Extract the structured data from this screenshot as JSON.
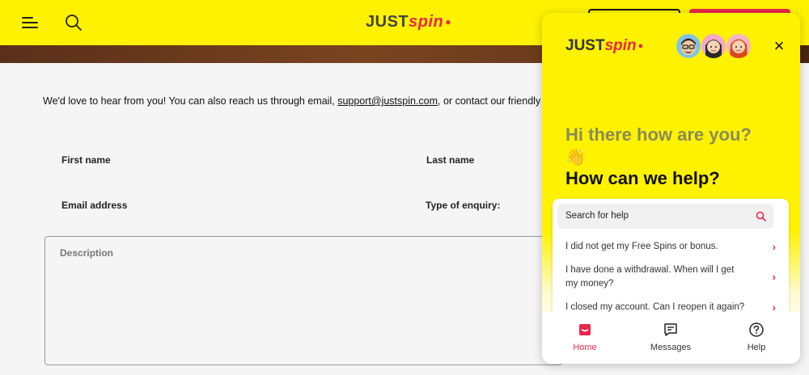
{
  "header": {
    "brand_just": "JUST",
    "brand_spin": "spin",
    "accent": "#e8284a",
    "background": "#fff200"
  },
  "contact": {
    "intro_prefix": "We'd love to hear from you! You can also reach us through email, ",
    "email": "support@justspin.com",
    "intro_suffix": ", or contact our friendly c",
    "first_name_label": "First name",
    "last_name_label": "Last name",
    "email_label": "Email address",
    "enquiry_label": "Type of enquiry:",
    "description_placeholder": "Description"
  },
  "widget": {
    "brand_just": "JUST",
    "brand_spin": "spin",
    "greeting": "Hi there how are you?",
    "wave": "👋",
    "help_title": "How can we help?",
    "search_placeholder": "Search for help",
    "faqs": [
      {
        "text": "I did not get my Free Spins or bonus."
      },
      {
        "text": "I have done a withdrawal. When will I get my money?"
      },
      {
        "text": "I closed my account. Can I reopen it again?"
      }
    ],
    "tabs": [
      {
        "label": "Home",
        "icon": "home-chat-icon",
        "active": true
      },
      {
        "label": "Messages",
        "icon": "messages-icon",
        "active": false
      },
      {
        "label": "Help",
        "icon": "help-icon",
        "active": false
      }
    ]
  }
}
